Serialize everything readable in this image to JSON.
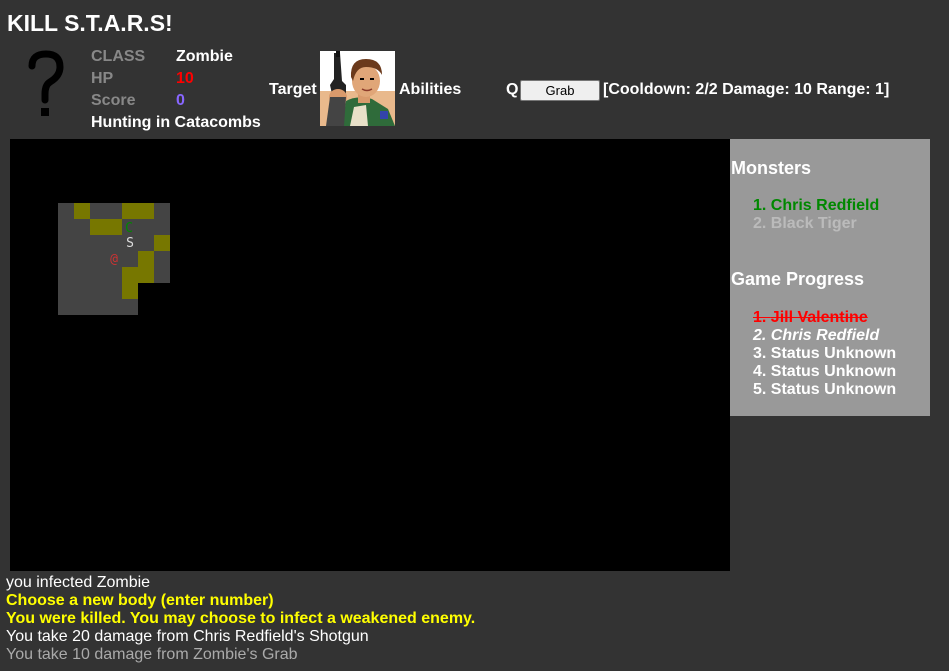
{
  "title": "KILL S.T.A.R.S!",
  "player": {
    "portrait_icon": "question-mark-icon",
    "class_label": "CLASS",
    "class_value": "Zombie",
    "hp_label": "HP",
    "hp_value": "10",
    "score_label": "Score",
    "score_value": "0",
    "hunting_text": "Hunting in Catacombs"
  },
  "target": {
    "label": "Target",
    "portrait_icon": "chris-redfield-portrait"
  },
  "abilities": {
    "label": "Abilities",
    "hotkey": "Q",
    "button_label": "Grab",
    "info": "[Cooldown: 2/2 Damage: 10 Range: 1]"
  },
  "map": {
    "glyphs": {
      "enemy": "C",
      "item": "S",
      "player": "@"
    }
  },
  "sidebar": {
    "monsters_heading": "Monsters",
    "monsters": [
      {
        "text": "1. Chris Redfield",
        "color": "#008800"
      },
      {
        "text": "2. Black Tiger",
        "color": "#bbbbbb"
      }
    ],
    "progress_heading": "Game Progress",
    "progress": [
      {
        "num": "1.",
        "name": "Jill Valentine",
        "state": "killed",
        "color": "#ff0000"
      },
      {
        "num": "2.",
        "name": "Chris Redfield",
        "state": "current",
        "color": "#ffffff"
      },
      {
        "num": "3.",
        "name": "Status Unknown",
        "state": "unknown",
        "color": "#ffffff"
      },
      {
        "num": "4.",
        "name": "Status Unknown",
        "state": "unknown",
        "color": "#ffffff"
      },
      {
        "num": "5.",
        "name": "Status Unknown",
        "state": "unknown",
        "color": "#ffffff"
      }
    ]
  },
  "log": [
    {
      "text": "you infected Zombie",
      "color": "#ffffff",
      "bold": false
    },
    {
      "text": "Choose a new body (enter number)",
      "color": "#ffff00",
      "bold": true
    },
    {
      "text": "You were killed. You may choose to infect a weakened enemy.",
      "color": "#ffff00",
      "bold": true
    },
    {
      "text": "You take 20 damage from Chris Redfield's Shotgun",
      "color": "#ffffff",
      "bold": false
    },
    {
      "text": "You take 10 damage from Zombie's Grab",
      "color": "#aaaaaa",
      "bold": false
    }
  ],
  "colors": {
    "background": "#333333",
    "hp": "#ff0000",
    "score": "#8866ff",
    "floor": "#444444",
    "wall": "#777700",
    "enemy_glyph": "#008800",
    "item_glyph": "#dddddd",
    "player_glyph": "#cc3333"
  }
}
